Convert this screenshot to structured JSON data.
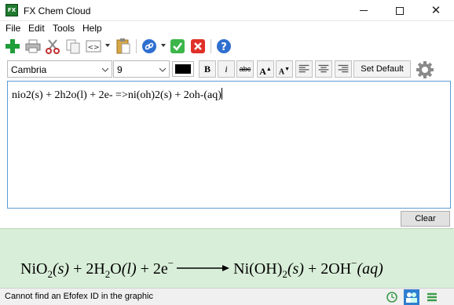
{
  "window": {
    "title": "FX Chem Cloud",
    "app_icon_label": "FX"
  },
  "menu": {
    "items": [
      "File",
      "Edit",
      "Tools",
      "Help"
    ]
  },
  "format": {
    "font_name": "Cambria",
    "font_size": "9",
    "text_color": "#000000",
    "bold_label": "B",
    "italic_label": "i",
    "strike_label": "abc",
    "grow_label": "A",
    "shrink_label": "A",
    "default_font_label": "Set Default Font"
  },
  "editor": {
    "text": "nio2(s) + 2h2o(l) + 2e- =>ni(oh)2(s) + 2oh-(aq)"
  },
  "clear_label": "Clear",
  "preview": {
    "lhs1": "NiO",
    "lhs1_sub": "2",
    "lhs1_state": "(s)",
    "plus1": " + 2H",
    "lhs2_sub": "2",
    "lhs2_rest": "O",
    "lhs2_state": "(l)",
    "plus2": " + 2e",
    "e_charge": "−",
    "rhs1": "Ni(OH)",
    "rhs1_sub": "2",
    "rhs1_state": "(s)",
    "plus3": " + 2OH",
    "oh_charge": "−",
    "rhs2_state": "(aq)"
  },
  "status": {
    "message": "Cannot find an Efofex ID in the graphic"
  },
  "colors": {
    "preview_bg": "#d9eed9",
    "editor_border": "#5b9bd5"
  }
}
